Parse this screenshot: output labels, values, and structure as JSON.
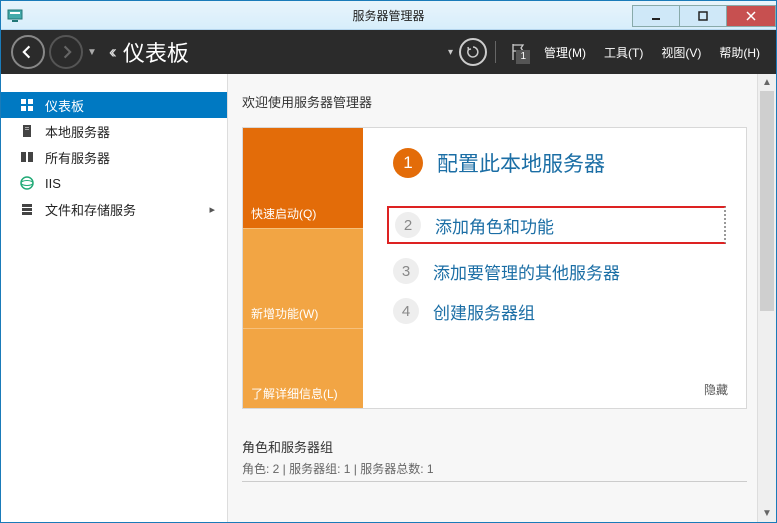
{
  "titlebar": {
    "title": "服务器管理器"
  },
  "header": {
    "breadcrumb": "仪表板",
    "flag_count": "1",
    "menu": {
      "manage": "管理(M)",
      "tools": "工具(T)",
      "view": "视图(V)",
      "help": "帮助(H)"
    }
  },
  "sidebar": {
    "items": [
      {
        "label": "仪表板"
      },
      {
        "label": "本地服务器"
      },
      {
        "label": "所有服务器"
      },
      {
        "label": "IIS"
      },
      {
        "label": "文件和存储服务"
      }
    ]
  },
  "main": {
    "welcome": "欢迎使用服务器管理器",
    "strips": {
      "quickstart": "快速启动(Q)",
      "whatsnew": "新增功能(W)",
      "learnmore": "了解详细信息(L)"
    },
    "tasks": [
      {
        "num": "1",
        "label": "配置此本地服务器"
      },
      {
        "num": "2",
        "label": "添加角色和功能"
      },
      {
        "num": "3",
        "label": "添加要管理的其他服务器"
      },
      {
        "num": "4",
        "label": "创建服务器组"
      }
    ],
    "hide": "隐藏",
    "section_title": "角色和服务器组",
    "section_sub": "角色: 2 | 服务器组: 1 | 服务器总数: 1"
  }
}
